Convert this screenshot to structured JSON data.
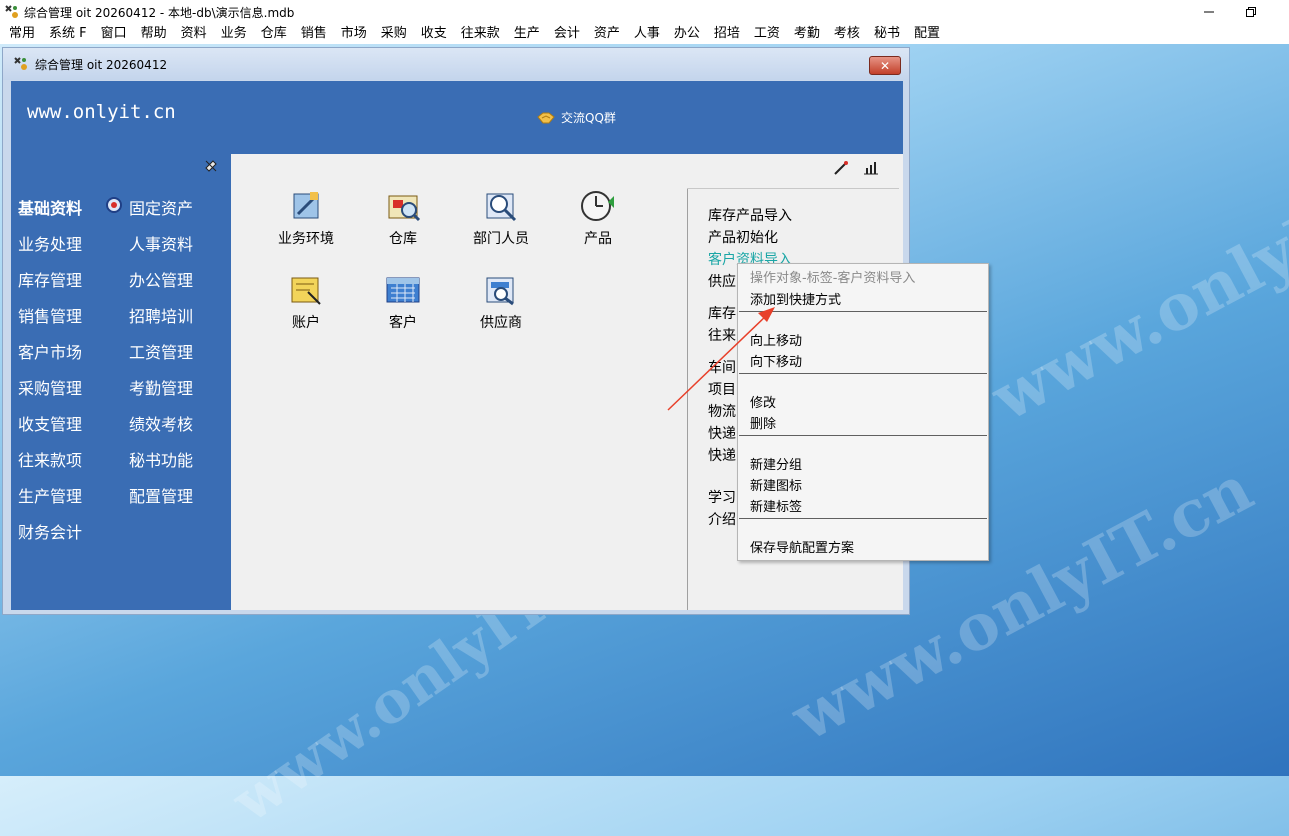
{
  "app": {
    "window_title": "综合管理 oit 20260412 - 本地-db\\演示信息.mdb",
    "child_title": "综合管理 oit 20260412"
  },
  "menubar": [
    "常用",
    "系统 F",
    "窗口",
    "帮助",
    "资料",
    "业务",
    "仓库",
    "销售",
    "市场",
    "采购",
    "收支",
    "往来款",
    "生产",
    "会计",
    "资产",
    "人事",
    "办公",
    "招培",
    "工资",
    "考勤",
    "考核",
    "秘书",
    "配置"
  ],
  "banner": {
    "url": "www.onlyit.cn",
    "qq_label": "交流QQ群"
  },
  "nav": [
    {
      "label": "基础资料",
      "active": true
    },
    {
      "label": "固定资产"
    },
    {
      "label": "业务处理"
    },
    {
      "label": "人事资料"
    },
    {
      "label": "库存管理"
    },
    {
      "label": "办公管理"
    },
    {
      "label": "销售管理"
    },
    {
      "label": "招聘培训"
    },
    {
      "label": "客户市场"
    },
    {
      "label": "工资管理"
    },
    {
      "label": "采购管理"
    },
    {
      "label": "考勤管理"
    },
    {
      "label": "收支管理"
    },
    {
      "label": "绩效考核"
    },
    {
      "label": "往来款项"
    },
    {
      "label": "秘书功能"
    },
    {
      "label": "生产管理"
    },
    {
      "label": "配置管理"
    },
    {
      "label": "财务会计"
    }
  ],
  "tiles": [
    {
      "label": "业务环境",
      "icon": "business-env-icon"
    },
    {
      "label": "仓库",
      "icon": "warehouse-icon"
    },
    {
      "label": "部门人员",
      "icon": "department-icon"
    },
    {
      "label": "产品",
      "icon": "product-clock-icon"
    },
    {
      "label": "账户",
      "icon": "account-icon"
    },
    {
      "label": "客户",
      "icon": "customer-icon"
    },
    {
      "label": "供应商",
      "icon": "supplier-icon"
    }
  ],
  "links": [
    "库存产品导入",
    "产品初始化",
    "客户资料导入",
    "供应",
    "库存",
    "往来",
    "车间",
    "项目",
    "物流",
    "快递",
    "快递",
    "学习",
    "介绍"
  ],
  "context_menu": {
    "header": "操作对象-标签-客户资料导入",
    "groups": [
      [
        "添加到快捷方式"
      ],
      [
        "向上移动",
        "向下移动"
      ],
      [
        "修改",
        "删除"
      ],
      [
        "新建分组",
        "新建图标",
        "新建标签"
      ],
      [
        "保存导航配置方案"
      ]
    ]
  },
  "desktop_watermark": [
    "www.onlyIT.cn",
    "www.onlyIT.cn",
    "www.onlyIT.cn"
  ],
  "colors": {
    "panel_blue": "#3a6db4",
    "highlight_link": "#1aa6a6",
    "arrow_red": "#e8402a"
  }
}
